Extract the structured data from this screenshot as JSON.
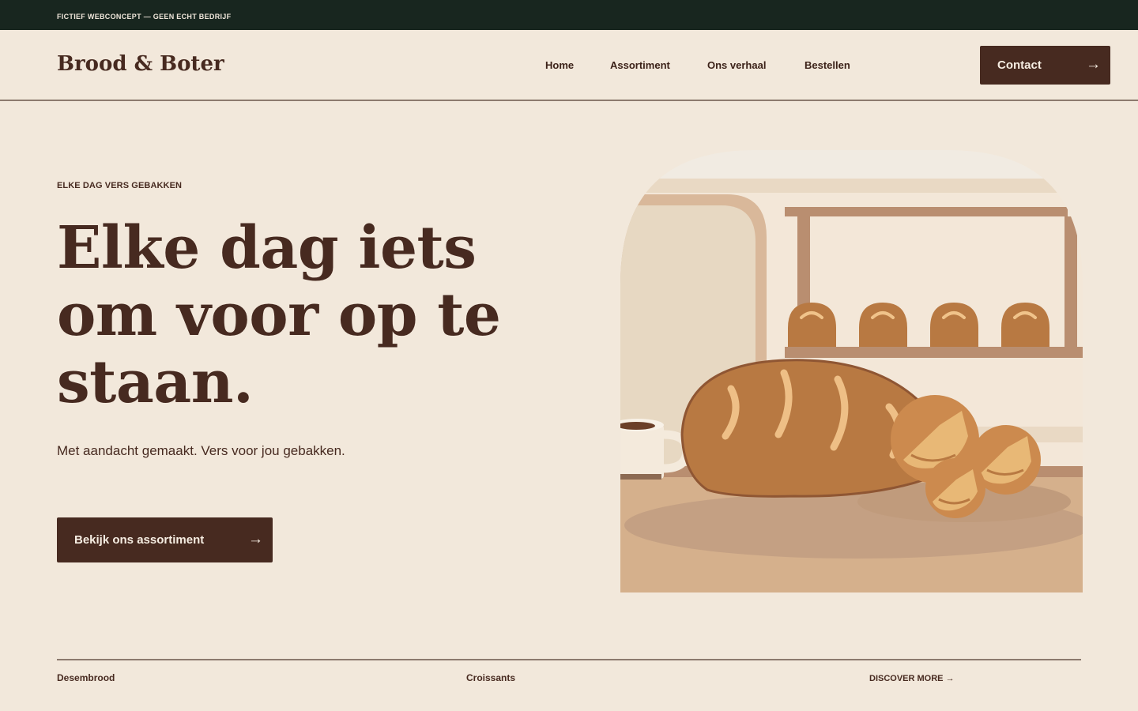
{
  "topbar": {
    "icon": "info-icon",
    "text": "FICTIEF WEBCONCEPT — GEEN ECHT BEDRIJF"
  },
  "header": {
    "logo": "Brood & Boter",
    "nav": [
      "Home",
      "Assortiment",
      "Ons verhaal",
      "Bestellen"
    ],
    "contact_label": "Contact",
    "arrow": "→"
  },
  "hero": {
    "eyebrow": "ELKE DAG VERS GEBAKKEN",
    "headline_lines": [
      "Elke dag iets",
      "om voor op te",
      "staan."
    ],
    "subtext": "Met aandacht gemaakt. Vers voor jou gebakken.",
    "cta_label": "Bekijk ons assortiment",
    "arrow": "→"
  },
  "bottom": {
    "items": [
      "Desembrood",
      "Croissants"
    ],
    "more": "DISCOVER MORE →"
  },
  "colors": {
    "background": "#f2e8db",
    "topbar": "#18261f",
    "brand_brown": "#472a20",
    "bread": "#b87942",
    "divider": "#8c7a6e"
  }
}
